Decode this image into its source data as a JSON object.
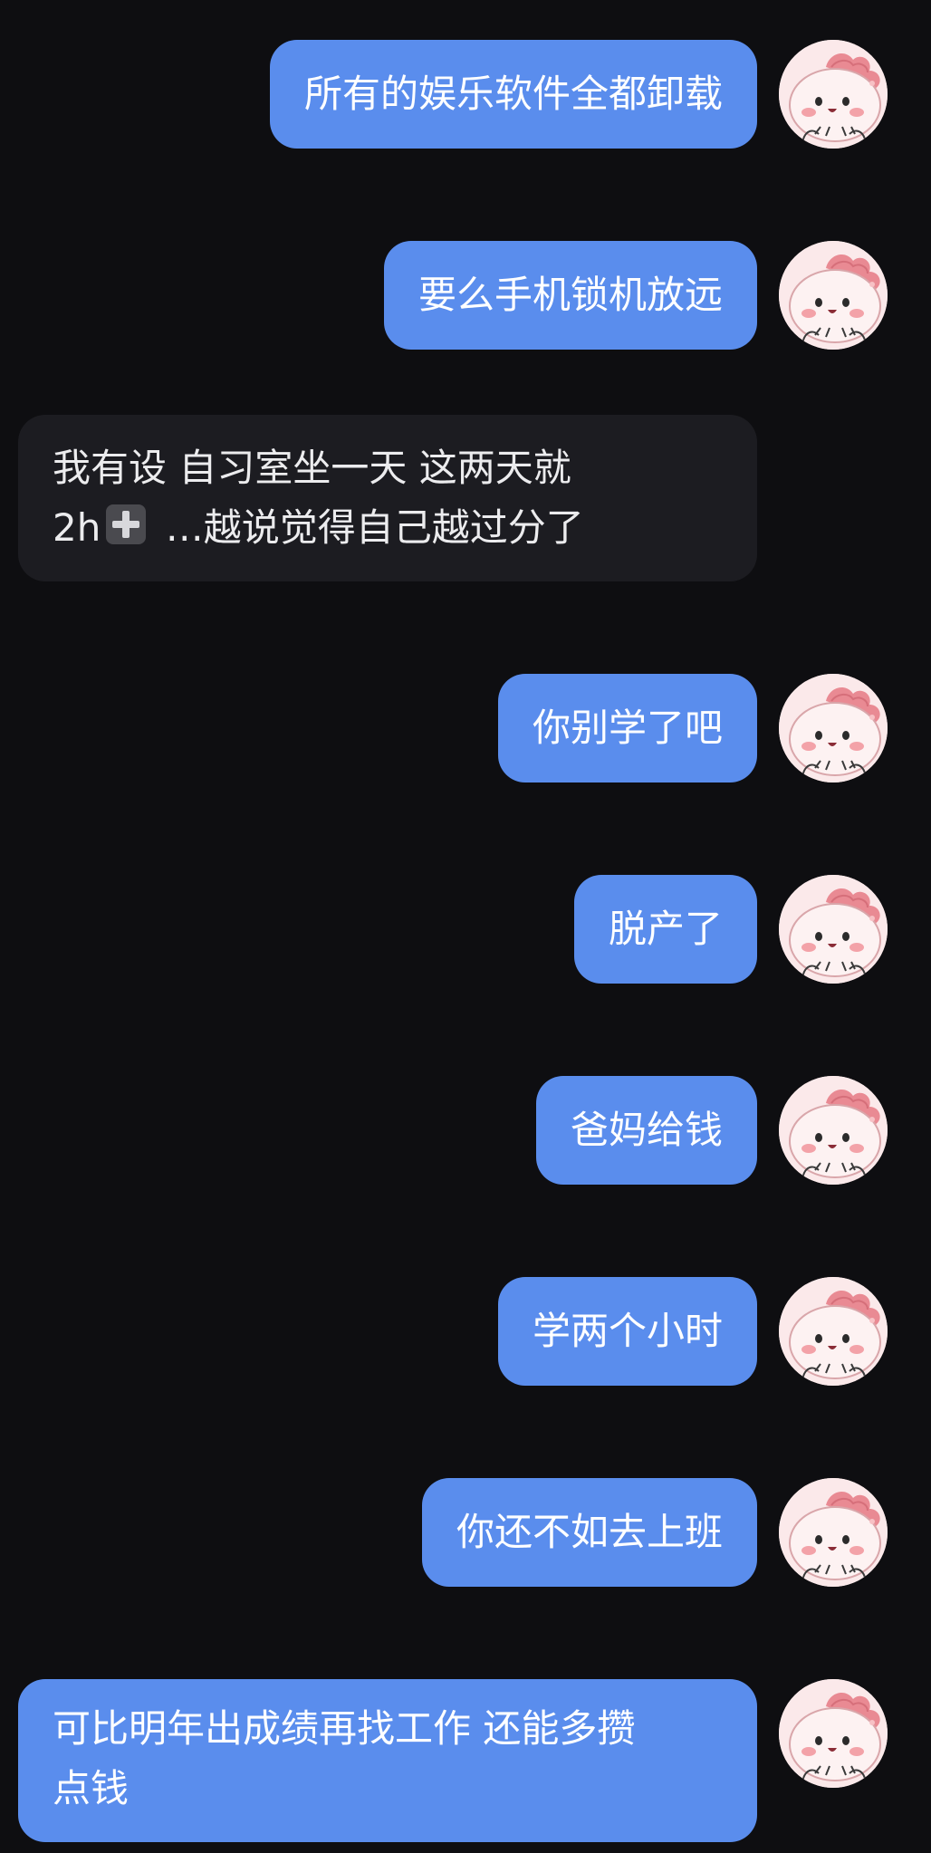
{
  "conversation": {
    "messages": [
      {
        "side": "sent",
        "text": "所有的娱乐软件全都卸载"
      },
      {
        "side": "sent",
        "text": "要么手机锁机放远"
      },
      {
        "side": "received",
        "text_line1": "我有设 自习室坐一天 这两天就",
        "text_line2_pre": "2h",
        "emoji": "heavy-plus-sign-emoji",
        "text_line2_post": " …越说觉得自己越过分了"
      },
      {
        "side": "sent",
        "text": "你别学了吧"
      },
      {
        "side": "sent",
        "text": "脱产了"
      },
      {
        "side": "sent",
        "text": "爸妈给钱"
      },
      {
        "side": "sent",
        "text": "学两个小时"
      },
      {
        "side": "sent",
        "text": "你还不如去上班"
      },
      {
        "side": "sent",
        "text_line1": "可比明年出成绩再找工作 还能多攒",
        "text_line2": "点钱"
      }
    ]
  },
  "colors": {
    "background": "#0e0e11",
    "sent_bubble": "#5a8ded",
    "received_bubble": "#1c1c21",
    "avatar_bg": "#fbe9ea"
  }
}
